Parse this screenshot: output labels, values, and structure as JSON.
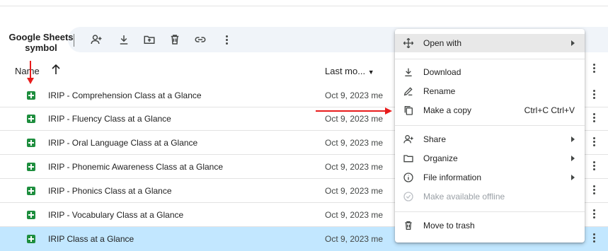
{
  "annotation": {
    "label_line1": "Google Sheets",
    "label_line2": "symbol",
    "arrow_color": "#e81c1c"
  },
  "toolbar": {
    "icons": [
      "add-person-icon",
      "download-icon",
      "move-to-folder-icon",
      "trash-icon",
      "link-icon",
      "more-vert-icon"
    ]
  },
  "list": {
    "name_header": "Name",
    "modified_header": "Last mo...",
    "rows": [
      {
        "name": "IRIP - Comprehension Class at a Glance",
        "date": "Oct 9, 2023 me"
      },
      {
        "name": "IRIP - Fluency Class at a Glance",
        "date": "Oct 9, 2023 me"
      },
      {
        "name": "IRIP - Oral Language Class at a Glance",
        "date": "Oct 9, 2023 me"
      },
      {
        "name": "IRIP - Phonemic Awareness Class at a Glance",
        "date": "Oct 9, 2023 me"
      },
      {
        "name": "IRIP - Phonics Class at a Glance",
        "date": "Oct 9, 2023 me"
      },
      {
        "name": "IRIP - Vocabulary Class at a Glance",
        "date": "Oct 9, 2023 me"
      },
      {
        "name": "IRIP Class at a Glance",
        "date": "Oct 9, 2023 me"
      }
    ]
  },
  "menu": {
    "open_with": "Open with",
    "download": "Download",
    "rename": "Rename",
    "make_copy": "Make a copy",
    "make_copy_shortcut": "Ctrl+C Ctrl+V",
    "share": "Share",
    "organize": "Organize",
    "file_information": "File information",
    "make_offline": "Make available offline",
    "move_to_trash": "Move to trash"
  },
  "colors": {
    "sheets_green": "#1e8e3e",
    "selected_row": "#c2e7ff",
    "toolbar_bg": "#f0f4f9"
  }
}
